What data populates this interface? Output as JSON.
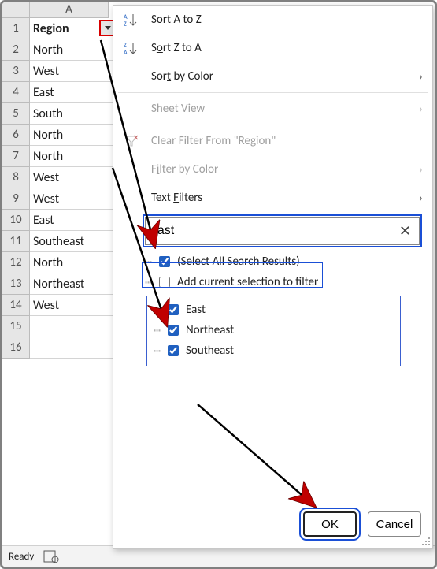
{
  "col_header": "A",
  "rows": [
    {
      "num": "1",
      "val": "Region"
    },
    {
      "num": "2",
      "val": "North"
    },
    {
      "num": "3",
      "val": "West"
    },
    {
      "num": "4",
      "val": "East"
    },
    {
      "num": "5",
      "val": "South"
    },
    {
      "num": "6",
      "val": "North"
    },
    {
      "num": "7",
      "val": "North"
    },
    {
      "num": "8",
      "val": "West"
    },
    {
      "num": "9",
      "val": "West"
    },
    {
      "num": "10",
      "val": "East"
    },
    {
      "num": "11",
      "val": "Southeast"
    },
    {
      "num": "12",
      "val": "North"
    },
    {
      "num": "13",
      "val": "Northeast"
    },
    {
      "num": "14",
      "val": "West"
    },
    {
      "num": "15",
      "val": ""
    },
    {
      "num": "16",
      "val": ""
    }
  ],
  "status": {
    "label": "Ready"
  },
  "menu": {
    "sort_az": "Sort A to Z",
    "sort_za": "Sort Z to A",
    "sort_color": "Sort by Color",
    "sheet_view": "Sheet View",
    "clear_filter": "Clear Filter From \"Region\"",
    "filter_color": "Filter by Color",
    "text_filters": "Text Filters"
  },
  "search": {
    "value": "east"
  },
  "checks": {
    "select_all": "(Select All Search Results)",
    "add_current": "Add current selection to filter",
    "items": [
      "East",
      "Northeast",
      "Southeast"
    ]
  },
  "buttons": {
    "ok": "OK",
    "cancel": "Cancel"
  }
}
